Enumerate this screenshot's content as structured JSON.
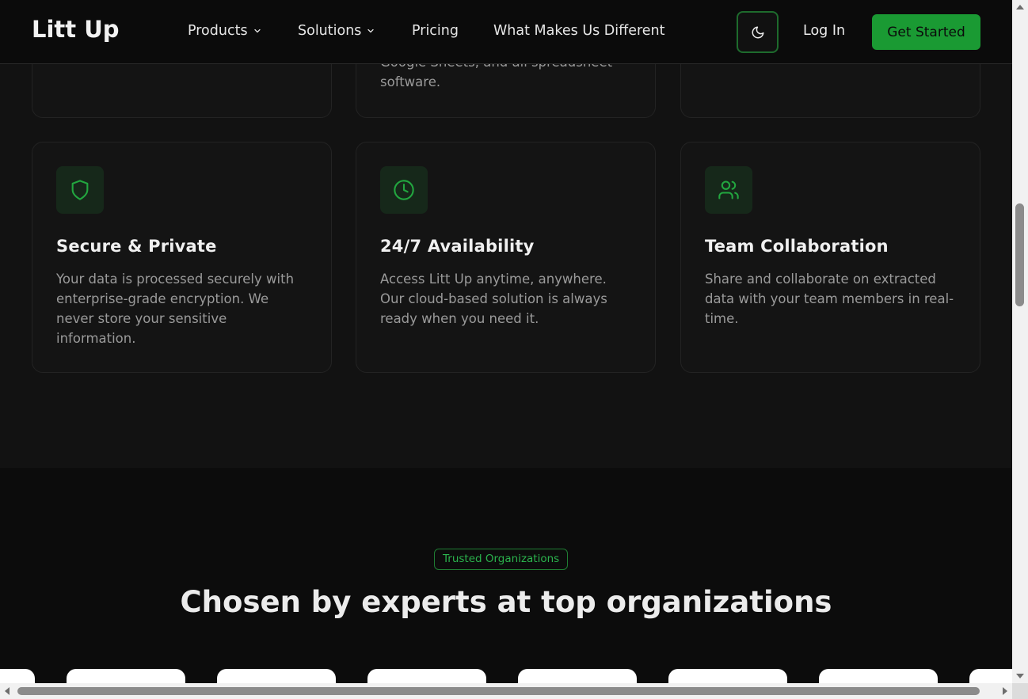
{
  "header": {
    "logo": "Litt Up",
    "nav": [
      {
        "label": "Products",
        "has_dropdown": true
      },
      {
        "label": "Solutions",
        "has_dropdown": true
      },
      {
        "label": "Pricing",
        "has_dropdown": false
      },
      {
        "label": "What Makes Us Different",
        "has_dropdown": false
      }
    ],
    "theme_icon": "moon-icon",
    "login_label": "Log In",
    "cta_label": "Get Started"
  },
  "features": {
    "top_row": [
      {
        "description": ""
      },
      {
        "description": "Google Sheets, and all spreadsheet software."
      },
      {
        "description": ""
      }
    ],
    "cards": [
      {
        "icon": "shield-icon",
        "title": "Secure & Private",
        "description": "Your data is processed securely with enterprise-grade encryption. We never store your sensitive information."
      },
      {
        "icon": "clock-icon",
        "title": "24/7 Availability",
        "description": "Access Litt Up anytime, anywhere. Our cloud-based solution is always ready when you need it."
      },
      {
        "icon": "users-icon",
        "title": "Team Collaboration",
        "description": "Share and collaborate on extracted data with your team members in real-time."
      }
    ]
  },
  "trusted": {
    "badge": "Trusted Organizations",
    "heading": "Chosen by experts at top organizations",
    "logo_count": 8
  },
  "colors": {
    "accent": "#1a9a33",
    "accent_text": "#2bb34d",
    "background": "#0c0c0c",
    "card": "#141414"
  }
}
